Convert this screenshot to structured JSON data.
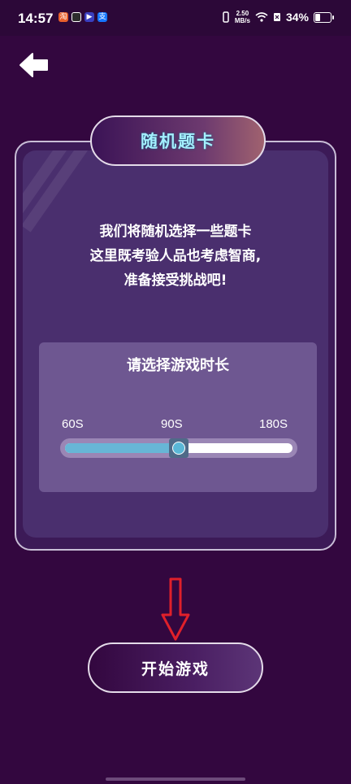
{
  "status_bar": {
    "time": "14:57",
    "net_speed_value": "2.50",
    "net_speed_unit": "MB/s",
    "battery_percent": "34%",
    "app_icons": [
      "taobao-icon",
      "app-icon",
      "media-icon",
      "alipay-icon"
    ]
  },
  "back_button": {
    "icon": "back-arrow-icon"
  },
  "card": {
    "title": "随机题卡",
    "description_lines": [
      "我们将随机选择一些题卡",
      "这里既考验人品也考虑智商,",
      "准备接受挑战吧!"
    ]
  },
  "duration": {
    "title": "请选择游戏时长",
    "options": [
      "60S",
      "90S",
      "180S"
    ],
    "selected": "90S",
    "slider_fraction": 0.5
  },
  "start_button": {
    "label": "开始游戏"
  },
  "colors": {
    "background": "#33073f",
    "title_text": "#a4f0ff",
    "slider_fill": "#67b6d6",
    "annotation_arrow": "#e0202a"
  }
}
